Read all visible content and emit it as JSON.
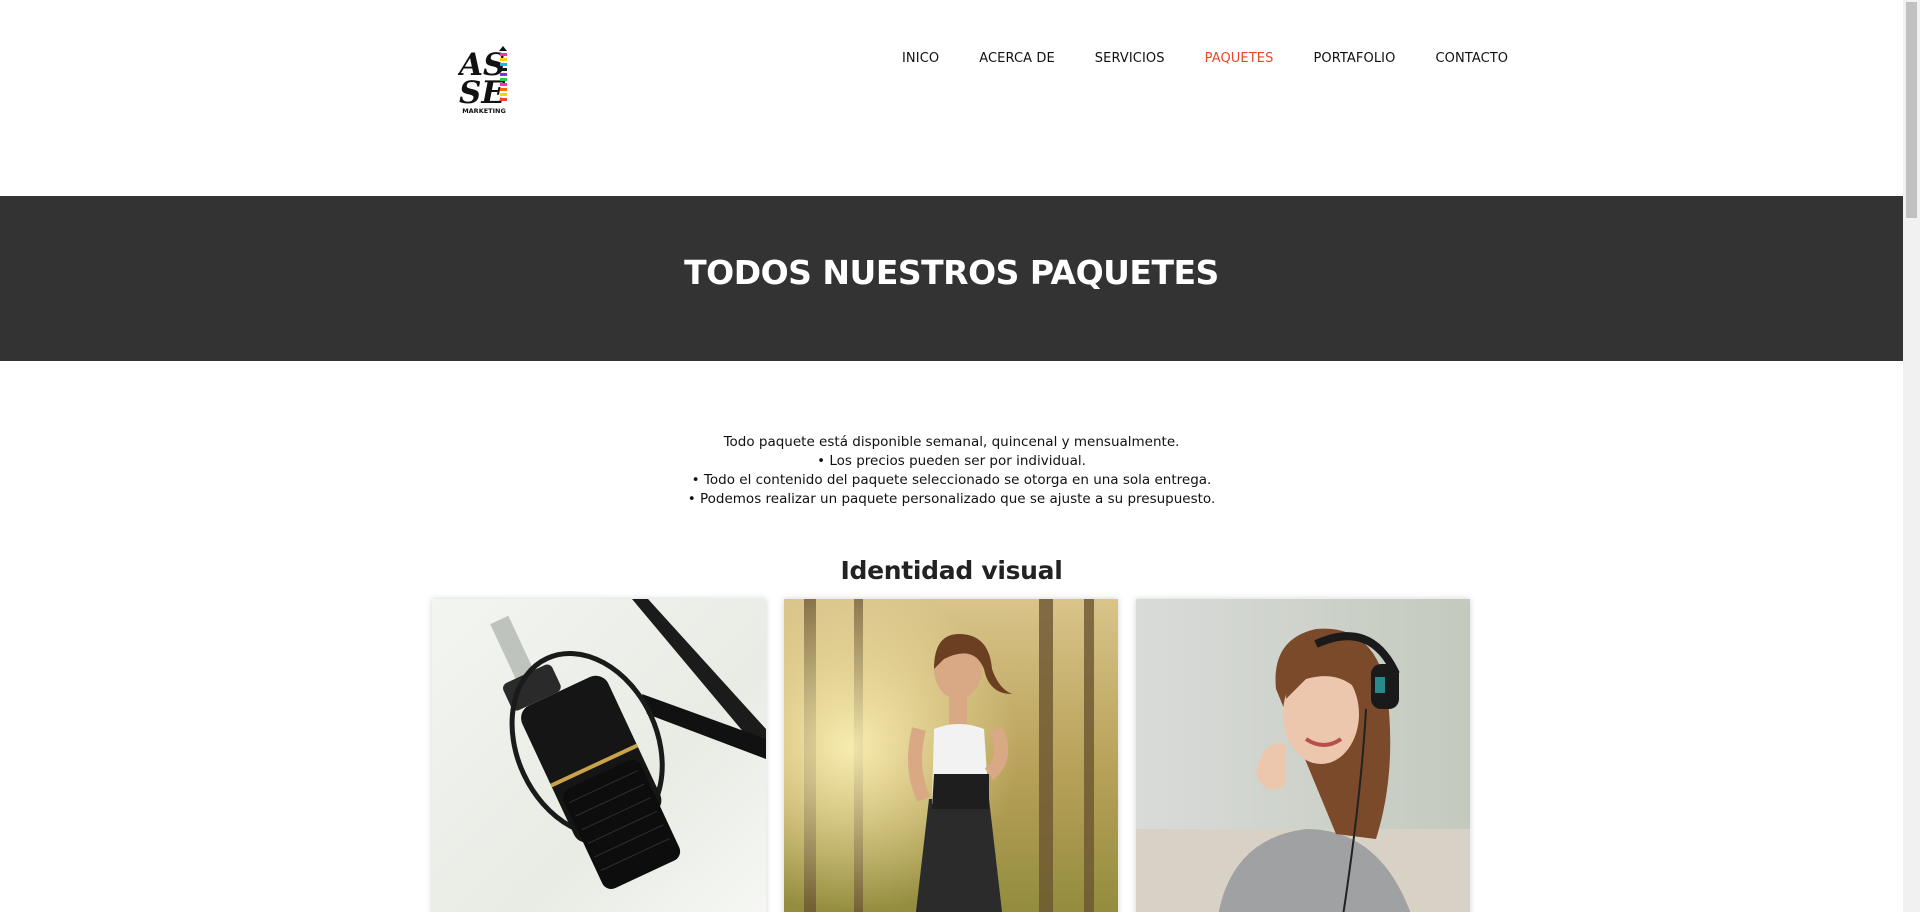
{
  "header": {
    "logo_text_top": "AS",
    "logo_text_bottom": "SE",
    "logo_caption": "MARKETING",
    "nav": [
      {
        "label": "INICO",
        "active": false
      },
      {
        "label": "ACERCA DE",
        "active": false
      },
      {
        "label": "SERVICIOS",
        "active": false
      },
      {
        "label": "PAQUETES",
        "active": true
      },
      {
        "label": "PORTAFOLIO",
        "active": false
      },
      {
        "label": "CONTACTO",
        "active": false
      }
    ]
  },
  "banner": {
    "title": "TODOS NUESTROS PAQUETES"
  },
  "info": {
    "lines": [
      "Todo paquete está disponible semanal, quincenal y mensualmente.",
      "• Los precios pueden ser por individual.",
      "• Todo el contenido del paquete seleccionado se otorga en una sola entrega.",
      "• Podemos realizar un paquete personalizado que se ajuste a su presupuesto."
    ]
  },
  "section": {
    "title": "Identidad visual"
  },
  "cards": [
    {
      "image": "microphone-photo"
    },
    {
      "image": "runner-woman-photo"
    },
    {
      "image": "woman-headphones-photo"
    }
  ],
  "colors": {
    "accent": "#e8472d",
    "banner_bg": "#333333"
  }
}
